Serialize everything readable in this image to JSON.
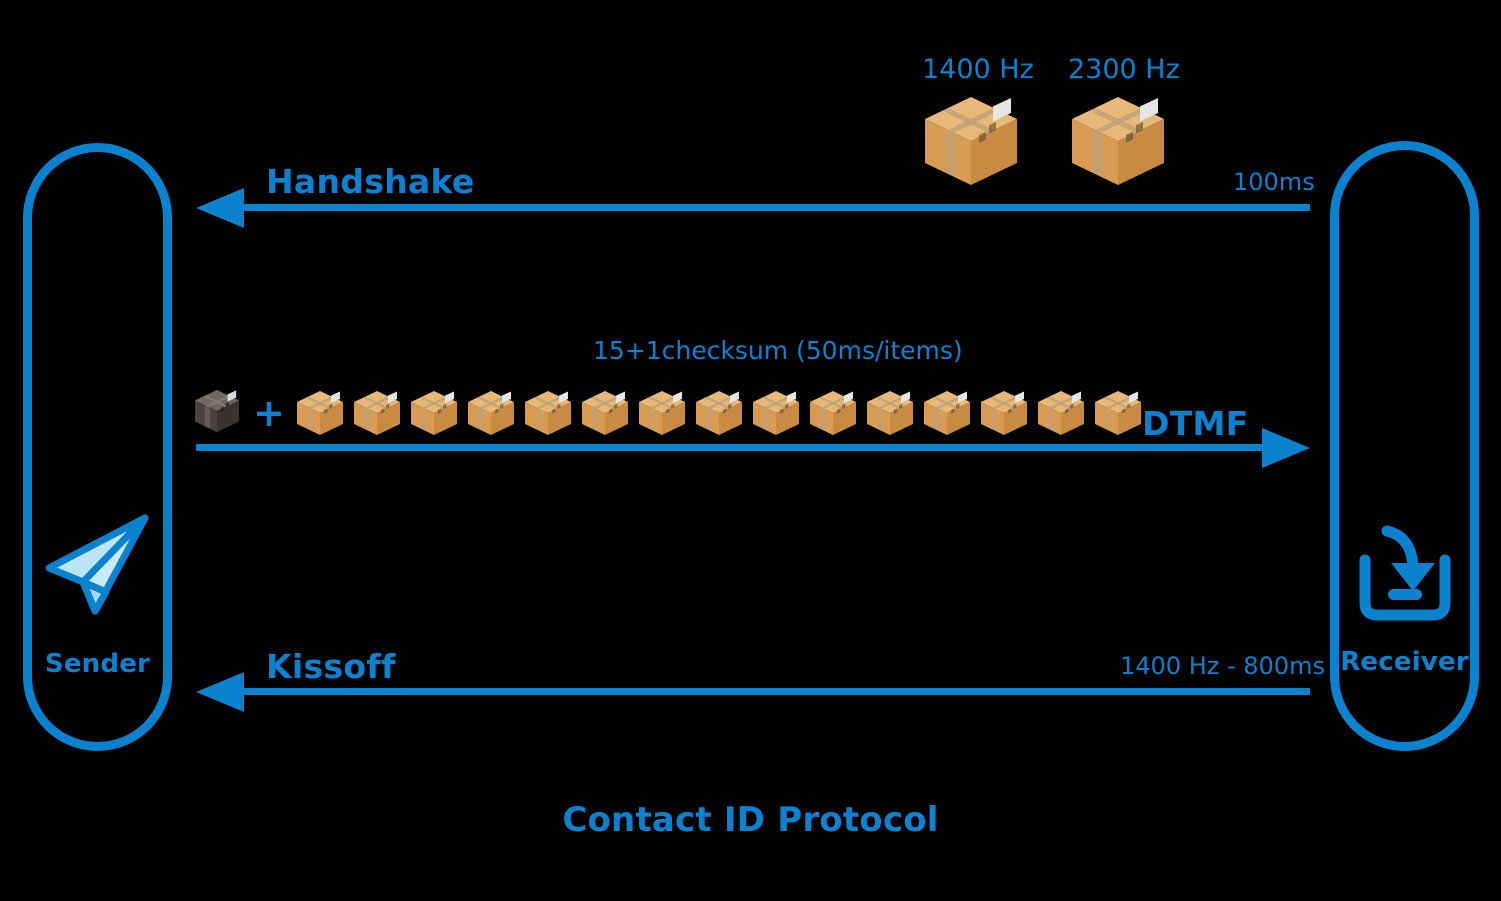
{
  "colors": {
    "blue": "#0B82D0",
    "background": "#000000",
    "carton_front": "#D99B52",
    "carton_top": "#E8B878",
    "carton_side": "#C98A43",
    "carton_tape": "#BFA177",
    "checksum_front": "#4A423E",
    "checksum_top": "#6E6762",
    "checksum_side": "#3A3330",
    "plane_fill": "#BFE4F5"
  },
  "title": "Contact ID Protocol",
  "sender": {
    "label": "Sender",
    "icon": "paper-plane-icon"
  },
  "receiver": {
    "label": "Receiver",
    "icon": "inbox-download-icon"
  },
  "frequencies": [
    {
      "label": "1400 Hz",
      "icon": "package-box-icon"
    },
    {
      "label": "2300 Hz",
      "icon": "package-box-icon"
    }
  ],
  "messages": {
    "handshake": {
      "label": "Handshake",
      "timing": "100ms",
      "direction": "left"
    },
    "dtmf": {
      "label": "DTMF",
      "note": "15+1checksum (50ms/items)",
      "direction": "right",
      "checksum_box_icon": "dark-package-box-icon",
      "plus": "+",
      "data_box_count": 15
    },
    "kissoff": {
      "label": "Kissoff",
      "timing": "1400 Hz - 800ms",
      "direction": "left"
    }
  }
}
